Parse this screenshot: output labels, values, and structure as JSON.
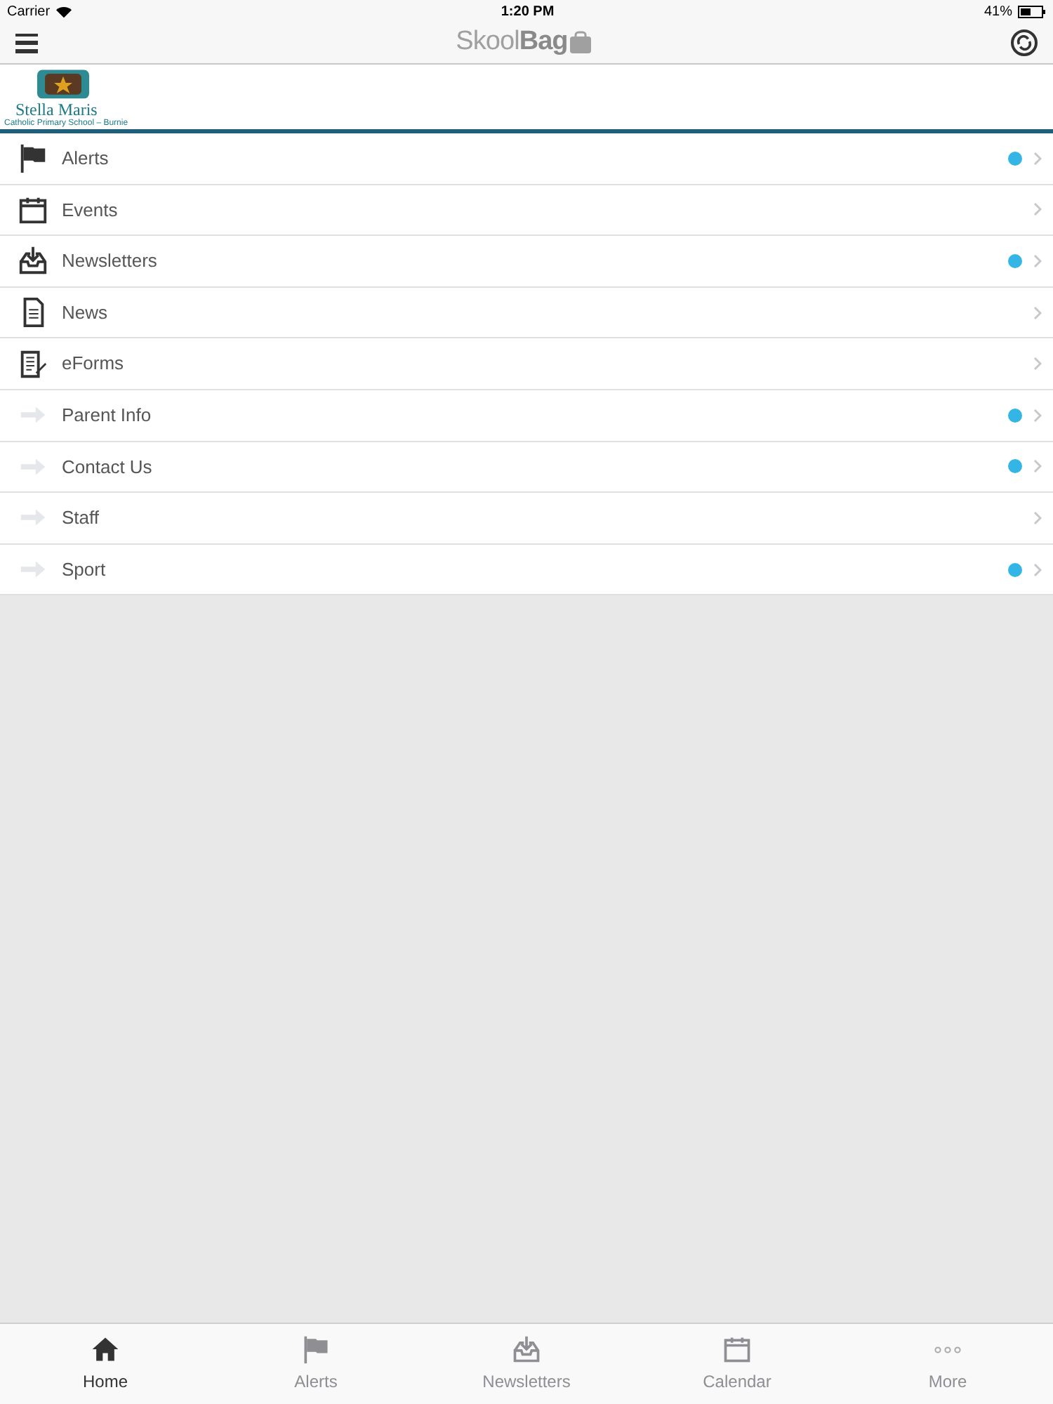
{
  "status_bar": {
    "carrier": "Carrier",
    "time": "1:20 PM",
    "battery": "41%"
  },
  "nav_bar": {
    "title_light": "Skool",
    "title_bold": "Bag"
  },
  "school": {
    "name": "Stella Maris",
    "subtitle": "Catholic Primary School – Burnie"
  },
  "menu": [
    {
      "label": "Alerts",
      "kind": "flag",
      "unread": true
    },
    {
      "label": "Events",
      "kind": "calendar",
      "unread": false
    },
    {
      "label": "Newsletters",
      "kind": "inbox",
      "unread": true
    },
    {
      "label": "News",
      "kind": "document",
      "unread": false
    },
    {
      "label": "eForms",
      "kind": "form",
      "unread": false
    },
    {
      "label": "Parent Info",
      "kind": "link",
      "unread": true
    },
    {
      "label": "Contact Us",
      "kind": "link",
      "unread": true
    },
    {
      "label": "Staff",
      "kind": "link",
      "unread": false
    },
    {
      "label": "Sport",
      "kind": "link",
      "unread": true
    }
  ],
  "tab_bar": [
    {
      "label": "Home",
      "kind": "home",
      "selected": true
    },
    {
      "label": "Alerts",
      "kind": "flag",
      "selected": false
    },
    {
      "label": "Newsletters",
      "kind": "inbox",
      "selected": false
    },
    {
      "label": "Calendar",
      "kind": "calendar",
      "selected": false
    },
    {
      "label": "More",
      "kind": "more",
      "selected": false
    }
  ]
}
